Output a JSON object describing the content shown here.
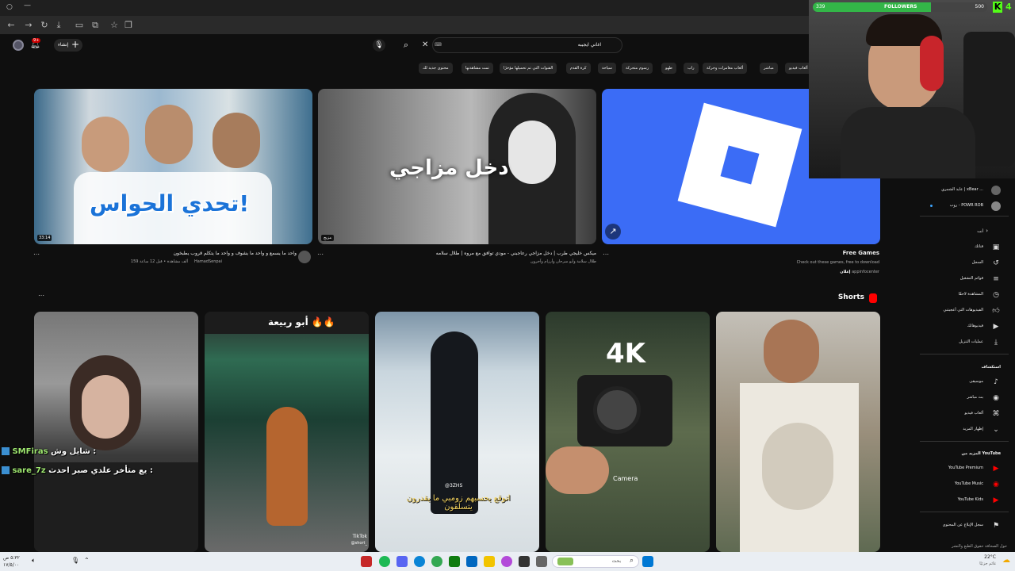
{
  "browser": {
    "window_controls": [
      "○",
      "—"
    ],
    "toolbar_icons": [
      "arrow-left-icon",
      "arrow-right-icon",
      "refresh-icon",
      "download-icon",
      "split-icon",
      "extensions-icon",
      "star-icon",
      "copy-icon"
    ]
  },
  "youtube": {
    "create_label": "إنشاء",
    "notif_count": "9+",
    "search_query": "اغاني ايجيبه",
    "search_placeholder": "بحث",
    "chips": [
      "ألعاب فيديو",
      "مباشر",
      "ألعاب مغامرات وحركة",
      "راب",
      "طهو",
      "رسوم متحركة",
      "سياحة",
      "كرة القدم",
      "القنوات التي تم تحميلها مؤخرًا",
      "تمت مشاهدتها",
      "محتوى جديد لك"
    ],
    "videos": [
      {
        "thumb_text": "تحدي الحواس!",
        "duration": "33:14",
        "title": "واحد ما يسمع و واحد ما يشوف و واحد ما يتكلم قروب يطبخون",
        "channel": "HamadSenpai",
        "meta": "159 ألف مشاهدة • قبل 12 ساعة"
      },
      {
        "thumb_text": "دخل مزاجي",
        "duration": "مزيج",
        "title": "ميكس خليجي طرب | دخل مزاجي رعاجبني - مودي توافق مع مروه | طلال سلامه",
        "channel": "طلال سلامة وأيو سرحان وأرزام وآخرون",
        "meta": ""
      },
      {
        "title": "Free Games",
        "desc": "Check out these games, free to download",
        "channel": "appinfocenter",
        "ad": "إعلان"
      }
    ],
    "shorts_title": "Shorts",
    "shorts": [
      {
        "overlay": ""
      },
      {
        "overlay": "أبو ربيعة 🔥🔥",
        "brand": "TikTok",
        "handle": "@short_"
      },
      {
        "overlay": "اتوقع يحسبهم زومبي ما يقدرون يتسلقون",
        "handle": "@3ZHS"
      },
      {
        "overlay": "4K",
        "caption": "Camera"
      },
      {
        "overlay": ""
      }
    ]
  },
  "sidebar": {
    "subs": [
      {
        "label": "عايد الشمري | xBear ..."
      },
      {
        "label": "روب - POWR ROB"
      }
    ],
    "you_title": "أنت",
    "you_items": [
      {
        "label": "قناتك",
        "icon": "user-icon"
      },
      {
        "label": "السجل",
        "icon": "history-icon"
      },
      {
        "label": "قوائم التشغيل",
        "icon": "playlist-icon"
      },
      {
        "label": "المشاهدة لاحقًا",
        "icon": "clock-icon"
      },
      {
        "label": "الفيديوهات التي أعجبتني",
        "icon": "like-icon"
      },
      {
        "label": "فيديوهاتك",
        "icon": "video-icon"
      },
      {
        "label": "عمليات التنزيل",
        "icon": "download-icon"
      }
    ],
    "explore_title": "استكشاف",
    "explore_items": [
      {
        "label": "موسيقى",
        "icon": "music-icon"
      },
      {
        "label": "بث مباشر",
        "icon": "live-icon"
      },
      {
        "label": "ألعاب فيديو",
        "icon": "game-icon"
      },
      {
        "label": "إظهار المزيد",
        "icon": "chevron-down-icon"
      }
    ],
    "more_title": "المزيد من YouTube",
    "more_items": [
      {
        "label": "YouTube Premium"
      },
      {
        "label": "YouTube Music"
      },
      {
        "label": "YouTube Kids"
      }
    ],
    "report": "سجل الإبلاغ عن المحتوى",
    "footer": "حول  الصحافة  حقوق الطبع والنشر"
  },
  "overlay": {
    "followers_label": "FOLLOWERS",
    "followers_current": "339",
    "followers_goal": "500",
    "followers_progress": 0.678,
    "kick_count": "4",
    "chat": [
      {
        "user": "SMFiras",
        "message": "شايل وش :"
      },
      {
        "user": "sare_7z",
        "message": "يع متأخر علدي صبر احدث :"
      }
    ]
  },
  "taskbar": {
    "search_placeholder": "بحث",
    "time": "٥:٣٢ ص",
    "date": "١٧/٥/٠٠",
    "weather_temp": "22°C",
    "weather_desc": "غائم جزئيًا"
  },
  "colors": {
    "accent": "#ff0000",
    "kick": "#53fc18",
    "bg": "#0f0f0f",
    "roblox": "#3b6cf6"
  }
}
